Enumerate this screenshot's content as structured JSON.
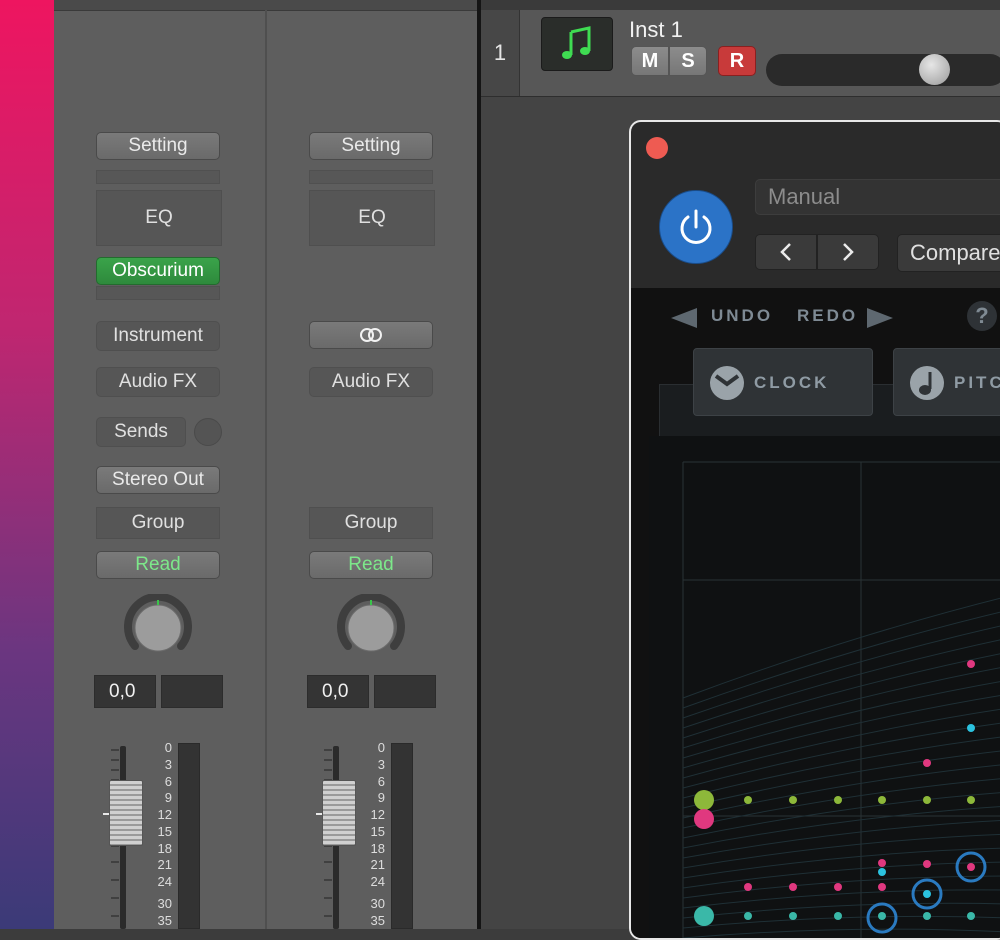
{
  "mixer": {
    "strips": [
      {
        "setting": "Setting",
        "eq": "EQ",
        "instrument_plugin": "Obscurium",
        "instrument_label": "Instrument",
        "audio_fx": "Audio FX",
        "sends": "Sends",
        "output": "Stereo Out",
        "group": "Group",
        "automation": "Read",
        "pan_value": "0,0"
      },
      {
        "setting": "Setting",
        "eq": "EQ",
        "link_icon": "link-rings-icon",
        "audio_fx": "Audio FX",
        "group": "Group",
        "automation": "Read",
        "pan_value": "0,0"
      }
    ],
    "scale": [
      "0",
      "3",
      "6",
      "9",
      "12",
      "15",
      "18",
      "21",
      "24",
      "30",
      "35"
    ]
  },
  "track": {
    "number": "1",
    "name": "Inst 1",
    "icon": "music-note-icon",
    "mute": "M",
    "solo": "S",
    "record": "R",
    "volume": 0.75
  },
  "plugin": {
    "preset": "Manual",
    "compare": "Compare",
    "undo": "UNDO",
    "redo": "REDO",
    "help": "?",
    "tabs": [
      {
        "label": "CLOCK",
        "icon": "clock-icon"
      },
      {
        "label": "PITC",
        "icon": "note-icon"
      }
    ]
  },
  "colors": {
    "record": "#c83a3a",
    "power": "#2b73c7",
    "green_slot": "#3aa34a",
    "read_text": "#7de88a",
    "dot_pink": "#e0387f",
    "dot_cyan": "#2bc3e0",
    "dot_green": "#8db83a",
    "dot_teal": "#3ab8a8"
  }
}
